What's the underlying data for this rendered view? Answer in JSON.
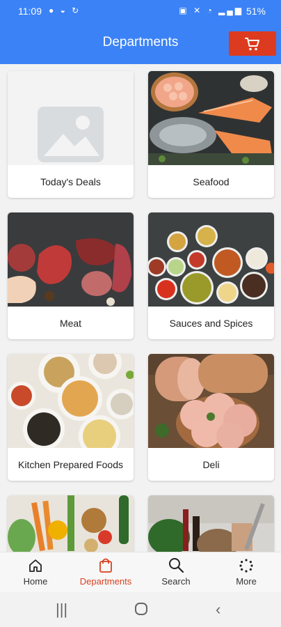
{
  "status_bar": {
    "time": "11:09",
    "battery": "51%"
  },
  "header": {
    "title": "Departments",
    "cart_icon": "cart-icon",
    "accent_color": "#3b82f6",
    "cart_color": "#dc3b1f"
  },
  "departments": [
    {
      "label": "Today's Deals"
    },
    {
      "label": "Seafood"
    },
    {
      "label": "Meat"
    },
    {
      "label": "Sauces and Spices"
    },
    {
      "label": "Kitchen Prepared Foods"
    },
    {
      "label": "Deli"
    },
    {
      "label": ""
    },
    {
      "label": ""
    }
  ],
  "bottom_nav": {
    "items": [
      {
        "label": "Home",
        "icon": "home-icon"
      },
      {
        "label": "Departments",
        "icon": "bag-icon",
        "active": true
      },
      {
        "label": "Search",
        "icon": "search-icon"
      },
      {
        "label": "More",
        "icon": "more-icon"
      }
    ],
    "active_color": "#d9401f"
  }
}
